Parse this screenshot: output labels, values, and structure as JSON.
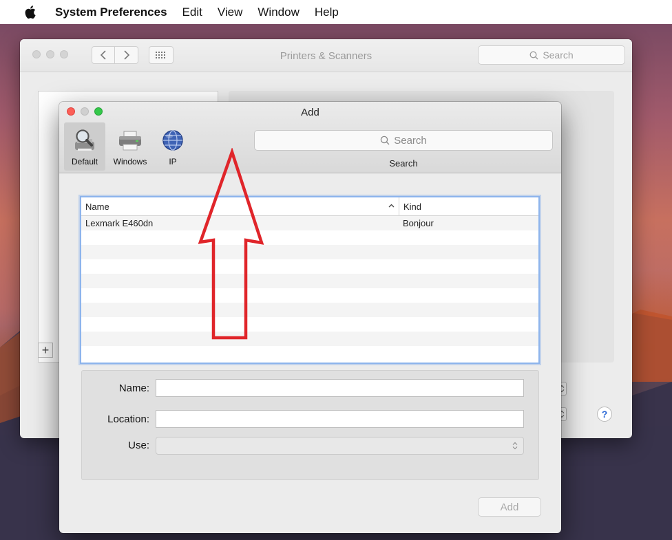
{
  "menubar": {
    "app_name": "System Preferences",
    "items": [
      "Edit",
      "View",
      "Window",
      "Help"
    ]
  },
  "prefs_window": {
    "title": "Printers & Scanners",
    "search_placeholder": "Search",
    "add_label": "+",
    "help_label": "?"
  },
  "add_dialog": {
    "title": "Add",
    "toolbar": [
      {
        "label": "Default",
        "icon": "default-printers-icon",
        "selected": true
      },
      {
        "label": "Windows",
        "icon": "windows-printer-icon",
        "selected": false
      },
      {
        "label": "IP",
        "icon": "ip-globe-icon",
        "selected": false
      }
    ],
    "search": {
      "placeholder": "Search",
      "caption": "Search"
    },
    "list": {
      "columns": [
        "Name",
        "Kind"
      ],
      "rows": [
        {
          "name": "Lexmark E460dn",
          "kind": "Bonjour"
        }
      ]
    },
    "form": {
      "name_label": "Name:",
      "location_label": "Location:",
      "use_label": "Use:",
      "name_value": "",
      "location_value": "",
      "use_value": ""
    },
    "add_button": "Add"
  },
  "annotation": {
    "arrow_color": "#e0252a"
  },
  "colors": {
    "focus_ring": "#8db4ec",
    "close": "#fc5f57",
    "zoom": "#34c84a"
  }
}
